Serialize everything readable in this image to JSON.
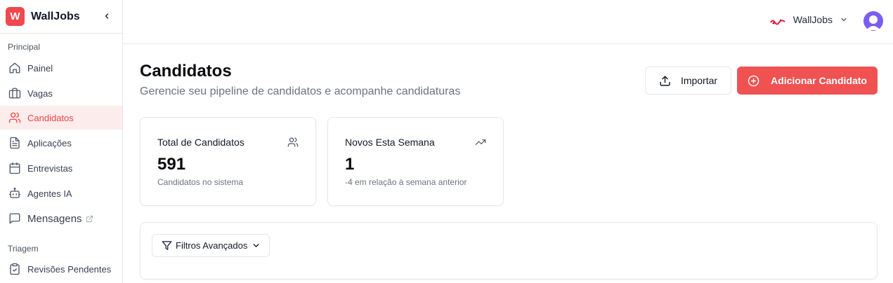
{
  "app": {
    "name": "WallJobs",
    "logo_letter": "W",
    "accent_color": "#f05252"
  },
  "sidebar": {
    "sections": [
      {
        "label": "Principal"
      },
      {
        "label": "Triagem"
      }
    ],
    "items": [
      {
        "label": "Painel",
        "icon": "home-icon"
      },
      {
        "label": "Vagas",
        "icon": "briefcase-icon"
      },
      {
        "label": "Candidatos",
        "icon": "users-icon",
        "active": true
      },
      {
        "label": "Aplicações",
        "icon": "file-text-icon"
      },
      {
        "label": "Entrevistas",
        "icon": "calendar-icon"
      },
      {
        "label": "Agentes IA",
        "icon": "bot-icon"
      },
      {
        "label": "Mensagens",
        "icon": "message-square-icon",
        "external": true
      },
      {
        "label": "Revisões Pendentes",
        "icon": "clipboard-check-icon"
      }
    ]
  },
  "header": {
    "org_name": "WallJobs"
  },
  "main": {
    "title": "Candidatos",
    "subtitle": "Gerencie seu pipeline de candidatos e acompanhe candidaturas",
    "import_label": "Importar",
    "add_label": "Adicionar Candidato"
  },
  "stats": [
    {
      "title": "Total de Candidatos",
      "value": "591",
      "description": "Candidatos no sistema",
      "icon": "users-icon"
    },
    {
      "title": "Novos Esta Semana",
      "value": "1",
      "description": "-4 em relação à semana anterior",
      "icon": "trending-up-icon"
    }
  ],
  "filters": {
    "label": "Filtros Avançados"
  }
}
